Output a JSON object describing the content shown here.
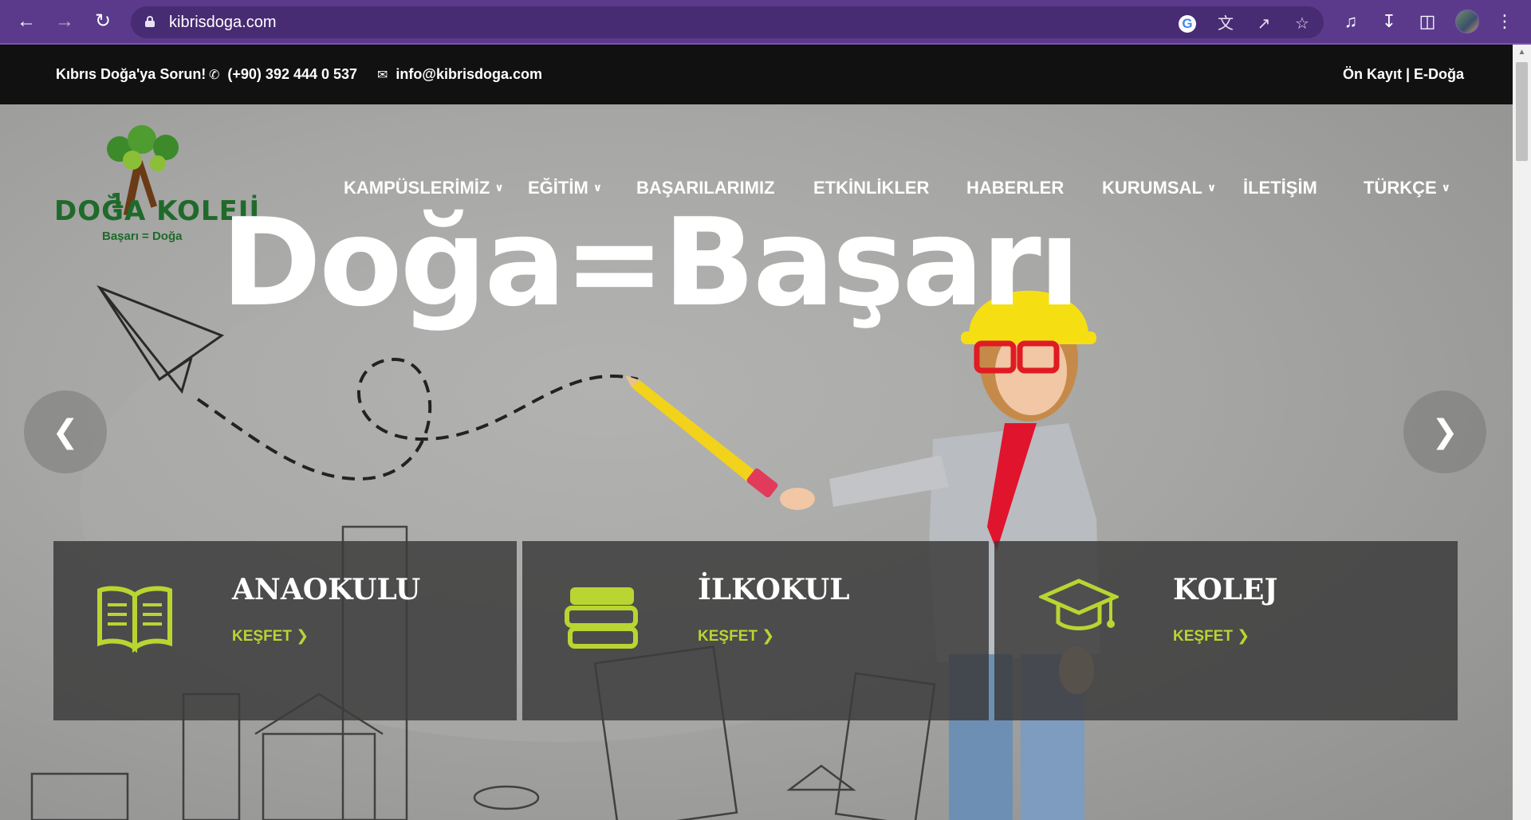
{
  "browser": {
    "url": "kibrisdoga.com"
  },
  "topbar": {
    "ask": "Kıbrıs Doğa'ya Sorun!",
    "phone": "(+90) 392 444 0 537",
    "email": "info@kibrisdoga.com",
    "right_links": "Ön Kayıt | E-Doğa"
  },
  "logo": {
    "number": "1",
    "name": "DOĞA KOLEJİ",
    "slogan": "Başarı = Doğa"
  },
  "nav": [
    {
      "label": "KAMPÜSLERİMİZ",
      "has_dropdown": true
    },
    {
      "label": "EĞİTİM",
      "has_dropdown": true
    },
    {
      "label": "BAŞARILARIMIZ",
      "has_dropdown": false
    },
    {
      "label": "ETKİNLİKLER",
      "has_dropdown": false
    },
    {
      "label": "HABERLER",
      "has_dropdown": false
    },
    {
      "label": "KURUMSAL",
      "has_dropdown": true
    },
    {
      "label": "İLETİŞİM",
      "has_dropdown": false
    },
    {
      "label": "TÜRKÇE",
      "has_dropdown": true
    }
  ],
  "hero": {
    "headline": "Doğa=Başarı"
  },
  "cards": [
    {
      "title": "ANAOKULU",
      "link": "KEŞFET",
      "icon": "open-book-icon"
    },
    {
      "title": "İLKOKUL",
      "link": "KEŞFET",
      "icon": "book-stack-icon"
    },
    {
      "title": "KOLEJ",
      "link": "KEŞFET",
      "icon": "graduation-cap-icon"
    }
  ],
  "colors": {
    "accent": "#b8d531",
    "brand_green": "#1f6a2b",
    "chrome": "#5b3a8c"
  }
}
